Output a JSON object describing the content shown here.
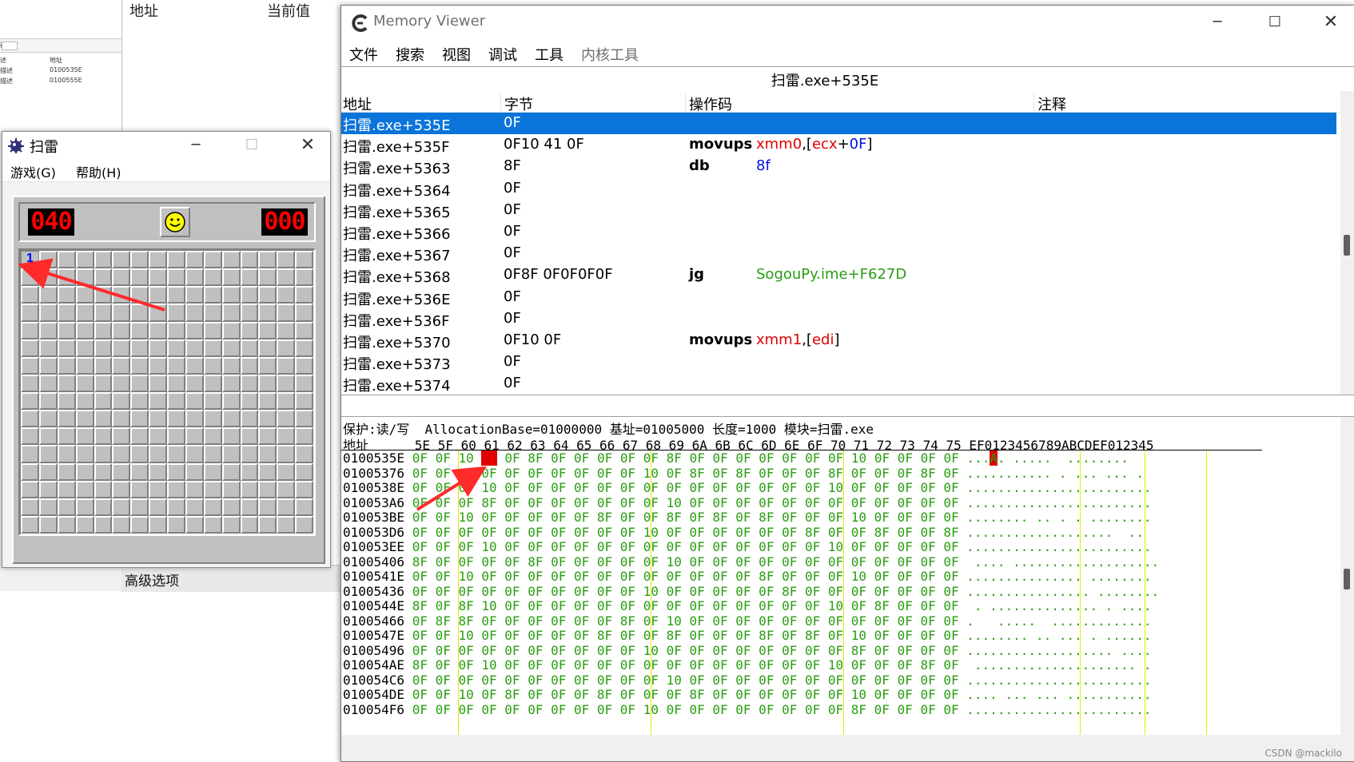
{
  "background_window": {
    "headers": [
      "地址",
      "当前值"
    ],
    "tiny_rows": [
      {
        "col1": "存",
        "col2": ""
      },
      {
        "col1": "述",
        "col2": "地址"
      },
      {
        "col1": "描述",
        "col2": "0100535E"
      },
      {
        "col1": "描述",
        "col2": "0100555E"
      }
    ],
    "advanced_options": "高级选项"
  },
  "minesweeper": {
    "title": "扫雷",
    "menu": [
      "游戏(G)",
      "帮助(H)"
    ],
    "mines_counter": "040",
    "timer": "000",
    "revealed_cell_value": "1",
    "grid_size": 16
  },
  "memory_viewer": {
    "title": "Memory Viewer",
    "menu": [
      "文件",
      "搜索",
      "视图",
      "调试",
      "工具",
      "内核工具"
    ],
    "address_bar": "扫雷.exe+535E",
    "disasm_headers": [
      "地址",
      "字节",
      "操作码",
      "注释"
    ],
    "disasm_rows": [
      {
        "addr": "扫雷.exe+535E",
        "bytes": "0F",
        "op": "",
        "args": [],
        "selected": true
      },
      {
        "addr": "扫雷.exe+535F",
        "bytes": "0F10 41 0F",
        "op": "movups",
        "args": [
          {
            "t": "xmm0",
            "c": "red"
          },
          {
            "t": ",[",
            "c": "dark"
          },
          {
            "t": "ecx",
            "c": "red"
          },
          {
            "t": "+",
            "c": "dark"
          },
          {
            "t": "0F",
            "c": "blue"
          },
          {
            "t": "]",
            "c": "dark"
          }
        ]
      },
      {
        "addr": "扫雷.exe+5363",
        "bytes": "8F",
        "op": "db",
        "args": [
          {
            "t": "8f",
            "c": "blue"
          }
        ]
      },
      {
        "addr": "扫雷.exe+5364",
        "bytes": "0F",
        "op": "",
        "args": []
      },
      {
        "addr": "扫雷.exe+5365",
        "bytes": "0F",
        "op": "",
        "args": []
      },
      {
        "addr": "扫雷.exe+5366",
        "bytes": "0F",
        "op": "",
        "args": []
      },
      {
        "addr": "扫雷.exe+5367",
        "bytes": "0F",
        "op": "",
        "args": []
      },
      {
        "addr": "扫雷.exe+5368",
        "bytes": "0F8F 0F0F0F0F",
        "op": "jg",
        "args": [
          {
            "t": "SogouPy.ime+F627D",
            "c": "green"
          }
        ]
      },
      {
        "addr": "扫雷.exe+536E",
        "bytes": "0F",
        "op": "",
        "args": []
      },
      {
        "addr": "扫雷.exe+536F",
        "bytes": "0F",
        "op": "",
        "args": []
      },
      {
        "addr": "扫雷.exe+5370",
        "bytes": "0F10 0F",
        "op": "movups",
        "args": [
          {
            "t": "xmm1",
            "c": "red"
          },
          {
            "t": ",[",
            "c": "dark"
          },
          {
            "t": "edi",
            "c": "red"
          },
          {
            "t": "]",
            "c": "dark"
          }
        ]
      },
      {
        "addr": "扫雷.exe+5373",
        "bytes": "0F",
        "op": "",
        "args": []
      },
      {
        "addr": "扫雷.exe+5374",
        "bytes": "0F",
        "op": "",
        "args": []
      }
    ],
    "hex_info": "保护:读/写  AllocationBase=01000000 基址=01005000 长度=1000 模块=扫雷.exe",
    "hex_header": "地址      5E 5F 60 61 62 63 64 65 66 67 68 69 6A 6B 6C 6D 6E 6F 70 71 72 73 74 75 EF0123456789ABCDEF012345",
    "hex_rows": [
      {
        "addr": "0100535E",
        "bytes": "0F 0F 10 41 0F 8F 0F 0F 0F 0F 0F 8F 0F 0F 0F 0F 0F 0F 0F 10 0F 0F 0F 0F",
        "text": "...A. .....  ........"
      },
      {
        "addr": "01005376",
        "bytes": "0F 0F 0F 0F 0F 0F 0F 0F 0F 0F 10 0F 8F 0F 8F 0F 0F 0F 8F 0F 0F 0F 8F 0F",
        "text": "........... . ... ... ."
      },
      {
        "addr": "0100538E",
        "bytes": "0F 0F 0F 10 0F 0F 0F 0F 0F 0F 0F 0F 0F 0F 0F 0F 0F 0F 10 0F 0F 0F 0F 0F",
        "text": "........................"
      },
      {
        "addr": "010053A6",
        "bytes": "0F 0F 0F 8F 0F 0F 0F 0F 0F 0F 0F 10 0F 0F 0F 0F 0F 0F 0F 0F 0F 0F 0F 0F",
        "text": "........................"
      },
      {
        "addr": "010053BE",
        "bytes": "0F 0F 10 0F 0F 0F 0F 0F 8F 0F 0F 8F 0F 8F 0F 8F 0F 0F 0F 10 0F 0F 0F 0F",
        "text": "........ .. . . ........"
      },
      {
        "addr": "010053D6",
        "bytes": "0F 0F 0F 0F 0F 0F 0F 0F 0F 0F 10 0F 0F 0F 0F 0F 0F 8F 0F 0F 8F 0F 0F 8F",
        "text": "...................  .. "
      },
      {
        "addr": "010053EE",
        "bytes": "0F 0F 0F 10 0F 0F 0F 0F 0F 0F 0F 0F 0F 0F 0F 0F 0F 0F 10 0F 0F 0F 0F 0F",
        "text": "........................"
      },
      {
        "addr": "01005406",
        "bytes": "8F 0F 0F 0F 0F 8F 0F 0F 0F 0F 0F 10 0F 0F 0F 0F 0F 0F 0F 0F 0F 0F 0F 0F",
        "text": " .... ..................."
      },
      {
        "addr": "0100541E",
        "bytes": "0F 0F 10 0F 0F 0F 0F 0F 0F 0F 0F 0F 0F 0F 0F 8F 0F 0F 0F 10 0F 0F 0F 0F",
        "text": "............... ........"
      },
      {
        "addr": "01005436",
        "bytes": "0F 0F 0F 0F 0F 0F 0F 0F 0F 0F 10 0F 0F 0F 0F 0F 8F 0F 0F 0F 0F 0F 0F 0F",
        "text": "................ ........"
      },
      {
        "addr": "0100544E",
        "bytes": "8F 0F 8F 10 0F 0F 0F 0F 0F 0F 0F 0F 0F 0F 0F 0F 0F 0F 10 0F 8F 0F 0F 0F",
        "text": " . .............. . ...."
      },
      {
        "addr": "01005466",
        "bytes": "0F 8F 8F 0F 0F 0F 0F 0F 0F 8F 0F 10 0F 0F 0F 0F 0F 0F 0F 0F 0F 0F 0F 0F",
        "text": ".   .....  ............."
      },
      {
        "addr": "0100547E",
        "bytes": "0F 0F 10 0F 0F 0F 0F 0F 8F 0F 0F 8F 0F 0F 0F 8F 0F 8F 0F 10 0F 0F 0F 0F",
        "text": "........ .. ... . ......"
      },
      {
        "addr": "01005496",
        "bytes": "0F 0F 0F 0F 0F 0F 0F 0F 0F 0F 10 0F 0F 0F 0F 0F 0F 0F 0F 8F 0F 0F 0F 0F",
        "text": "................... ...."
      },
      {
        "addr": "010054AE",
        "bytes": "8F 0F 0F 10 0F 0F 0F 0F 0F 0F 0F 0F 0F 0F 0F 0F 0F 0F 10 0F 0F 0F 8F 0F",
        "text": " ..................... ."
      },
      {
        "addr": "010054C6",
        "bytes": "0F 0F 0F 0F 0F 0F 0F 0F 0F 0F 0F 10 0F 0F 0F 0F 0F 0F 0F 0F 0F 0F 0F 0F",
        "text": "........................"
      },
      {
        "addr": "010054DE",
        "bytes": "0F 0F 10 0F 8F 0F 0F 0F 8F 0F 0F 0F 8F 0F 0F 0F 0F 0F 0F 10 0F 0F 0F 0F",
        "text": ".... ... ... ..........."
      },
      {
        "addr": "010054F6",
        "bytes": "0F 0F 0F 0F 0F 0F 0F 0F 0F 0F 10 0F 0F 0F 0F 0F 0F 0F 0F 8F 0F 0F 0F 0F",
        "text": "........................"
      }
    ],
    "watermark": "CSDN @mackilo"
  },
  "colors": {
    "selection": "#0a74da",
    "highlight_red": "#e00000",
    "hex_green": "#2a9d12",
    "lcd_red": "#ff0000"
  }
}
